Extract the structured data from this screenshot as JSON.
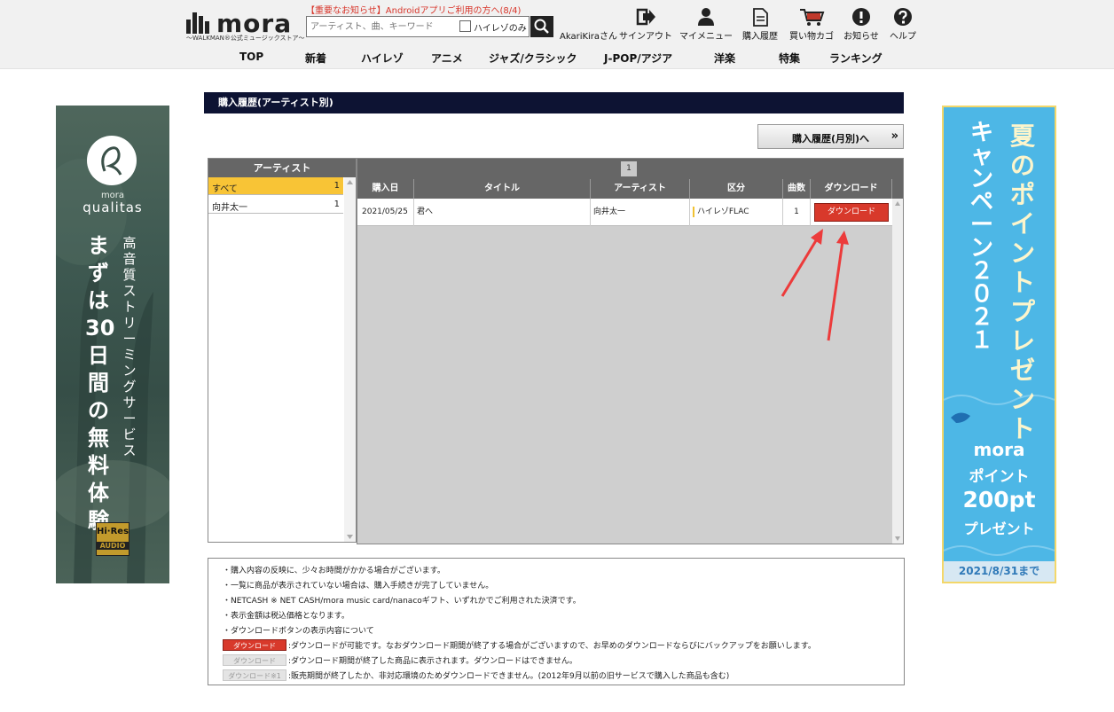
{
  "header": {
    "logo_text": "mora",
    "logo_sub": "～WALKMAN®公式ミュージックストア～",
    "notice": "【重要なお知らせ】Androidアプリご利用の方へ(8/4)",
    "search_placeholder": "アーティスト、曲、キーワード",
    "hires_only_label": "ハイレゾのみ",
    "user_name": "AkariKiraさん",
    "icon_nav": [
      {
        "label": "サインアウト",
        "icon": "signout-icon"
      },
      {
        "label": "マイメニュー",
        "icon": "user-icon"
      },
      {
        "label": "購入履歴",
        "icon": "document-icon"
      },
      {
        "label": "買い物カゴ",
        "icon": "cart-icon"
      },
      {
        "label": "お知らせ",
        "icon": "exclamation-icon"
      },
      {
        "label": "ヘルプ",
        "icon": "question-icon"
      }
    ],
    "main_nav": [
      "TOP",
      "新着",
      "ハイレゾ",
      "アニメ",
      "ジャズ/クラシック",
      "J-POP/アジア",
      "洋楽",
      "特集",
      "ランキング"
    ]
  },
  "banner_left": {
    "brand_small": "mora",
    "brand": "qualitas",
    "headline": "まずは30日間の無料体験",
    "subline": "高音質ストリーミングサービス",
    "badge_top": "Hi·Res",
    "badge_bottom": "AUDIO"
  },
  "banner_right": {
    "line_a": "夏のポイントプレゼント",
    "line_b": "キャンペーン２０２１",
    "brand": "mora",
    "point_label": "ポイント",
    "amount": "200pt",
    "present": "プレゼント",
    "date": "2021/8/31まで"
  },
  "page": {
    "title": "購入履歴(アーティスト別)",
    "monthly_button": "購入履歴(月別)へ",
    "monthly_arrow": "»"
  },
  "artists": {
    "header": "アーティスト",
    "items": [
      {
        "name": "すべて",
        "count": "1",
        "selected": true
      },
      {
        "name": "向井太一",
        "count": "1",
        "selected": false
      }
    ]
  },
  "list": {
    "page_number": "1",
    "columns": [
      "購入日",
      "タイトル",
      "アーティスト",
      "区分",
      "曲数",
      "ダウンロード"
    ],
    "rows": [
      {
        "date": "2021/05/25",
        "title": "君へ",
        "artist": "向井太一",
        "kind": "ハイレゾFLAC",
        "tracks": "1",
        "download": "ダウンロード"
      }
    ]
  },
  "notes": {
    "lines": [
      "・購入内容の反映に、少々お時間がかかる場合がございます。",
      "・一覧に商品が表示されていない場合は、購入手続きが完了していません。",
      "・NETCASH ※  NET CASH/mora music card/nanacoギフト、いずれかでご利用された決済です。",
      "・表示金額は税込価格となります。",
      "・ダウンロードボタンの表示内容について"
    ],
    "legend": [
      {
        "tag": "ダウンロード",
        "desc": ":ダウンロードが可能です。なおダウンロード期間が終了する場合がございますので、お早めのダウンロードならびにバックアップをお願いします。"
      },
      {
        "tag": "ダウンロード",
        "desc": ":ダウンロード期間が終了した商品に表示されます。ダウンロードはできません。"
      },
      {
        "tag": "ダウンロード※1",
        "desc": ":販売期間が終了したか、非対応環境のためダウンロードできません。(2012年9月以前の旧サービスで購入した商品も含む)"
      }
    ]
  }
}
